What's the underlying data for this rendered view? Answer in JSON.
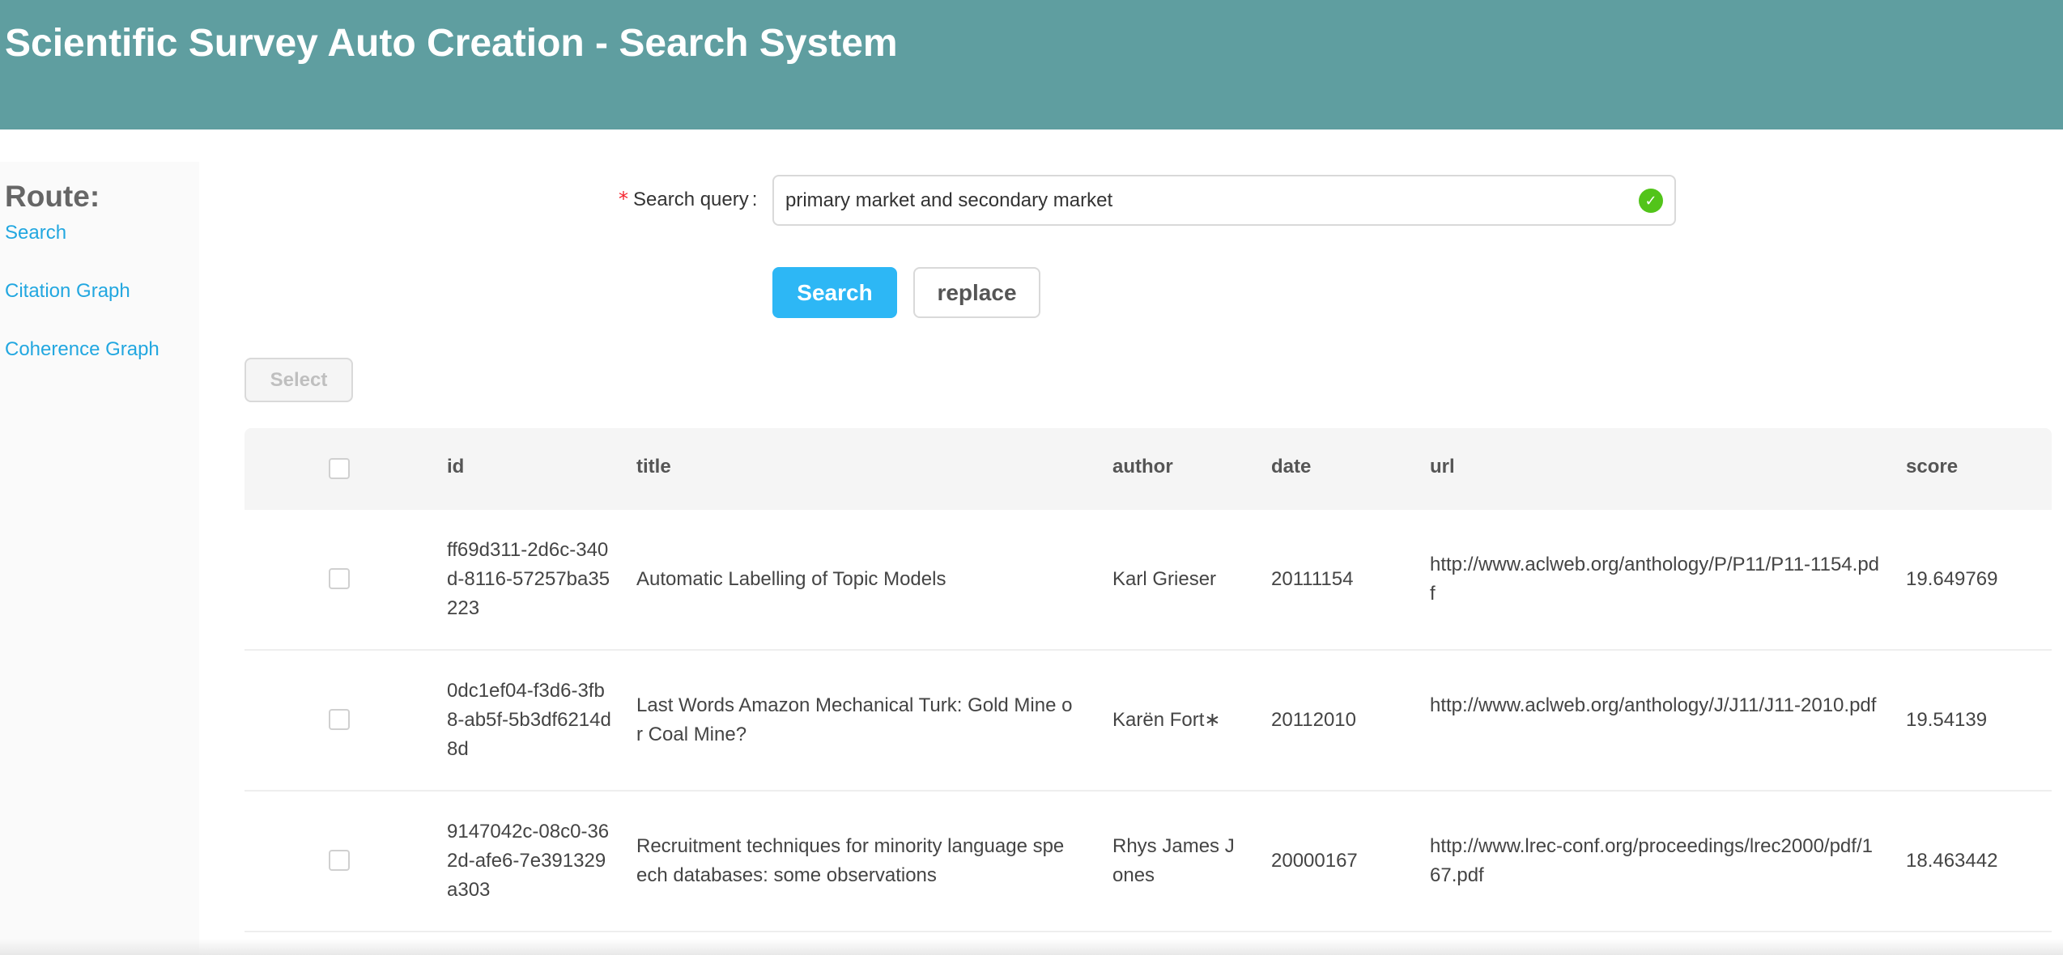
{
  "header": {
    "title": "Scientific Survey Auto Creation - Search System"
  },
  "sidebar": {
    "title": "Route:",
    "items": [
      {
        "label": "Search"
      },
      {
        "label": "Citation Graph"
      },
      {
        "label": "Coherence Graph"
      }
    ]
  },
  "search": {
    "required_mark": "*",
    "label": "Search query",
    "label_suffix": ":",
    "value": "primary market and secondary market",
    "status_icon": "check-circle-icon",
    "search_button": "Search",
    "replace_button": "replace"
  },
  "select_button": "Select",
  "table": {
    "columns": [
      "id",
      "title",
      "author",
      "date",
      "url",
      "score"
    ],
    "rows": [
      {
        "id": "ff69d311-2d6c-340d-8116-57257ba35223",
        "title": "Automatic Labelling of Topic Models",
        "author": "Karl Grieser",
        "date": "20111154",
        "url": "http://www.aclweb.org/anthology/P/P11/P11-1154.pdf",
        "score": "19.649769"
      },
      {
        "id": "0dc1ef04-f3d6-3fb8-ab5f-5b3df6214d8d",
        "title": "Last Words Amazon Mechanical Turk: Gold Mine or Coal Mine?",
        "author": "Karën Fort∗",
        "date": "20112010",
        "url": "http://www.aclweb.org/anthology/J/J11/J11-2010.pdf",
        "score": "19.54139"
      },
      {
        "id": "9147042c-08c0-362d-afe6-7e391329a303",
        "title": "Recruitment techniques for minority language speech databases: some observations",
        "author": "Rhys James Jones",
        "date": "20000167",
        "url": "http://www.lrec-conf.org/proceedings/lrec2000/pdf/167.pdf",
        "score": "18.463442"
      }
    ]
  },
  "colors": {
    "header_bg": "#5f9ea0",
    "link": "#22a7e0",
    "primary_button": "#2db7f5",
    "success": "#52c41a",
    "required": "#f5222d"
  }
}
